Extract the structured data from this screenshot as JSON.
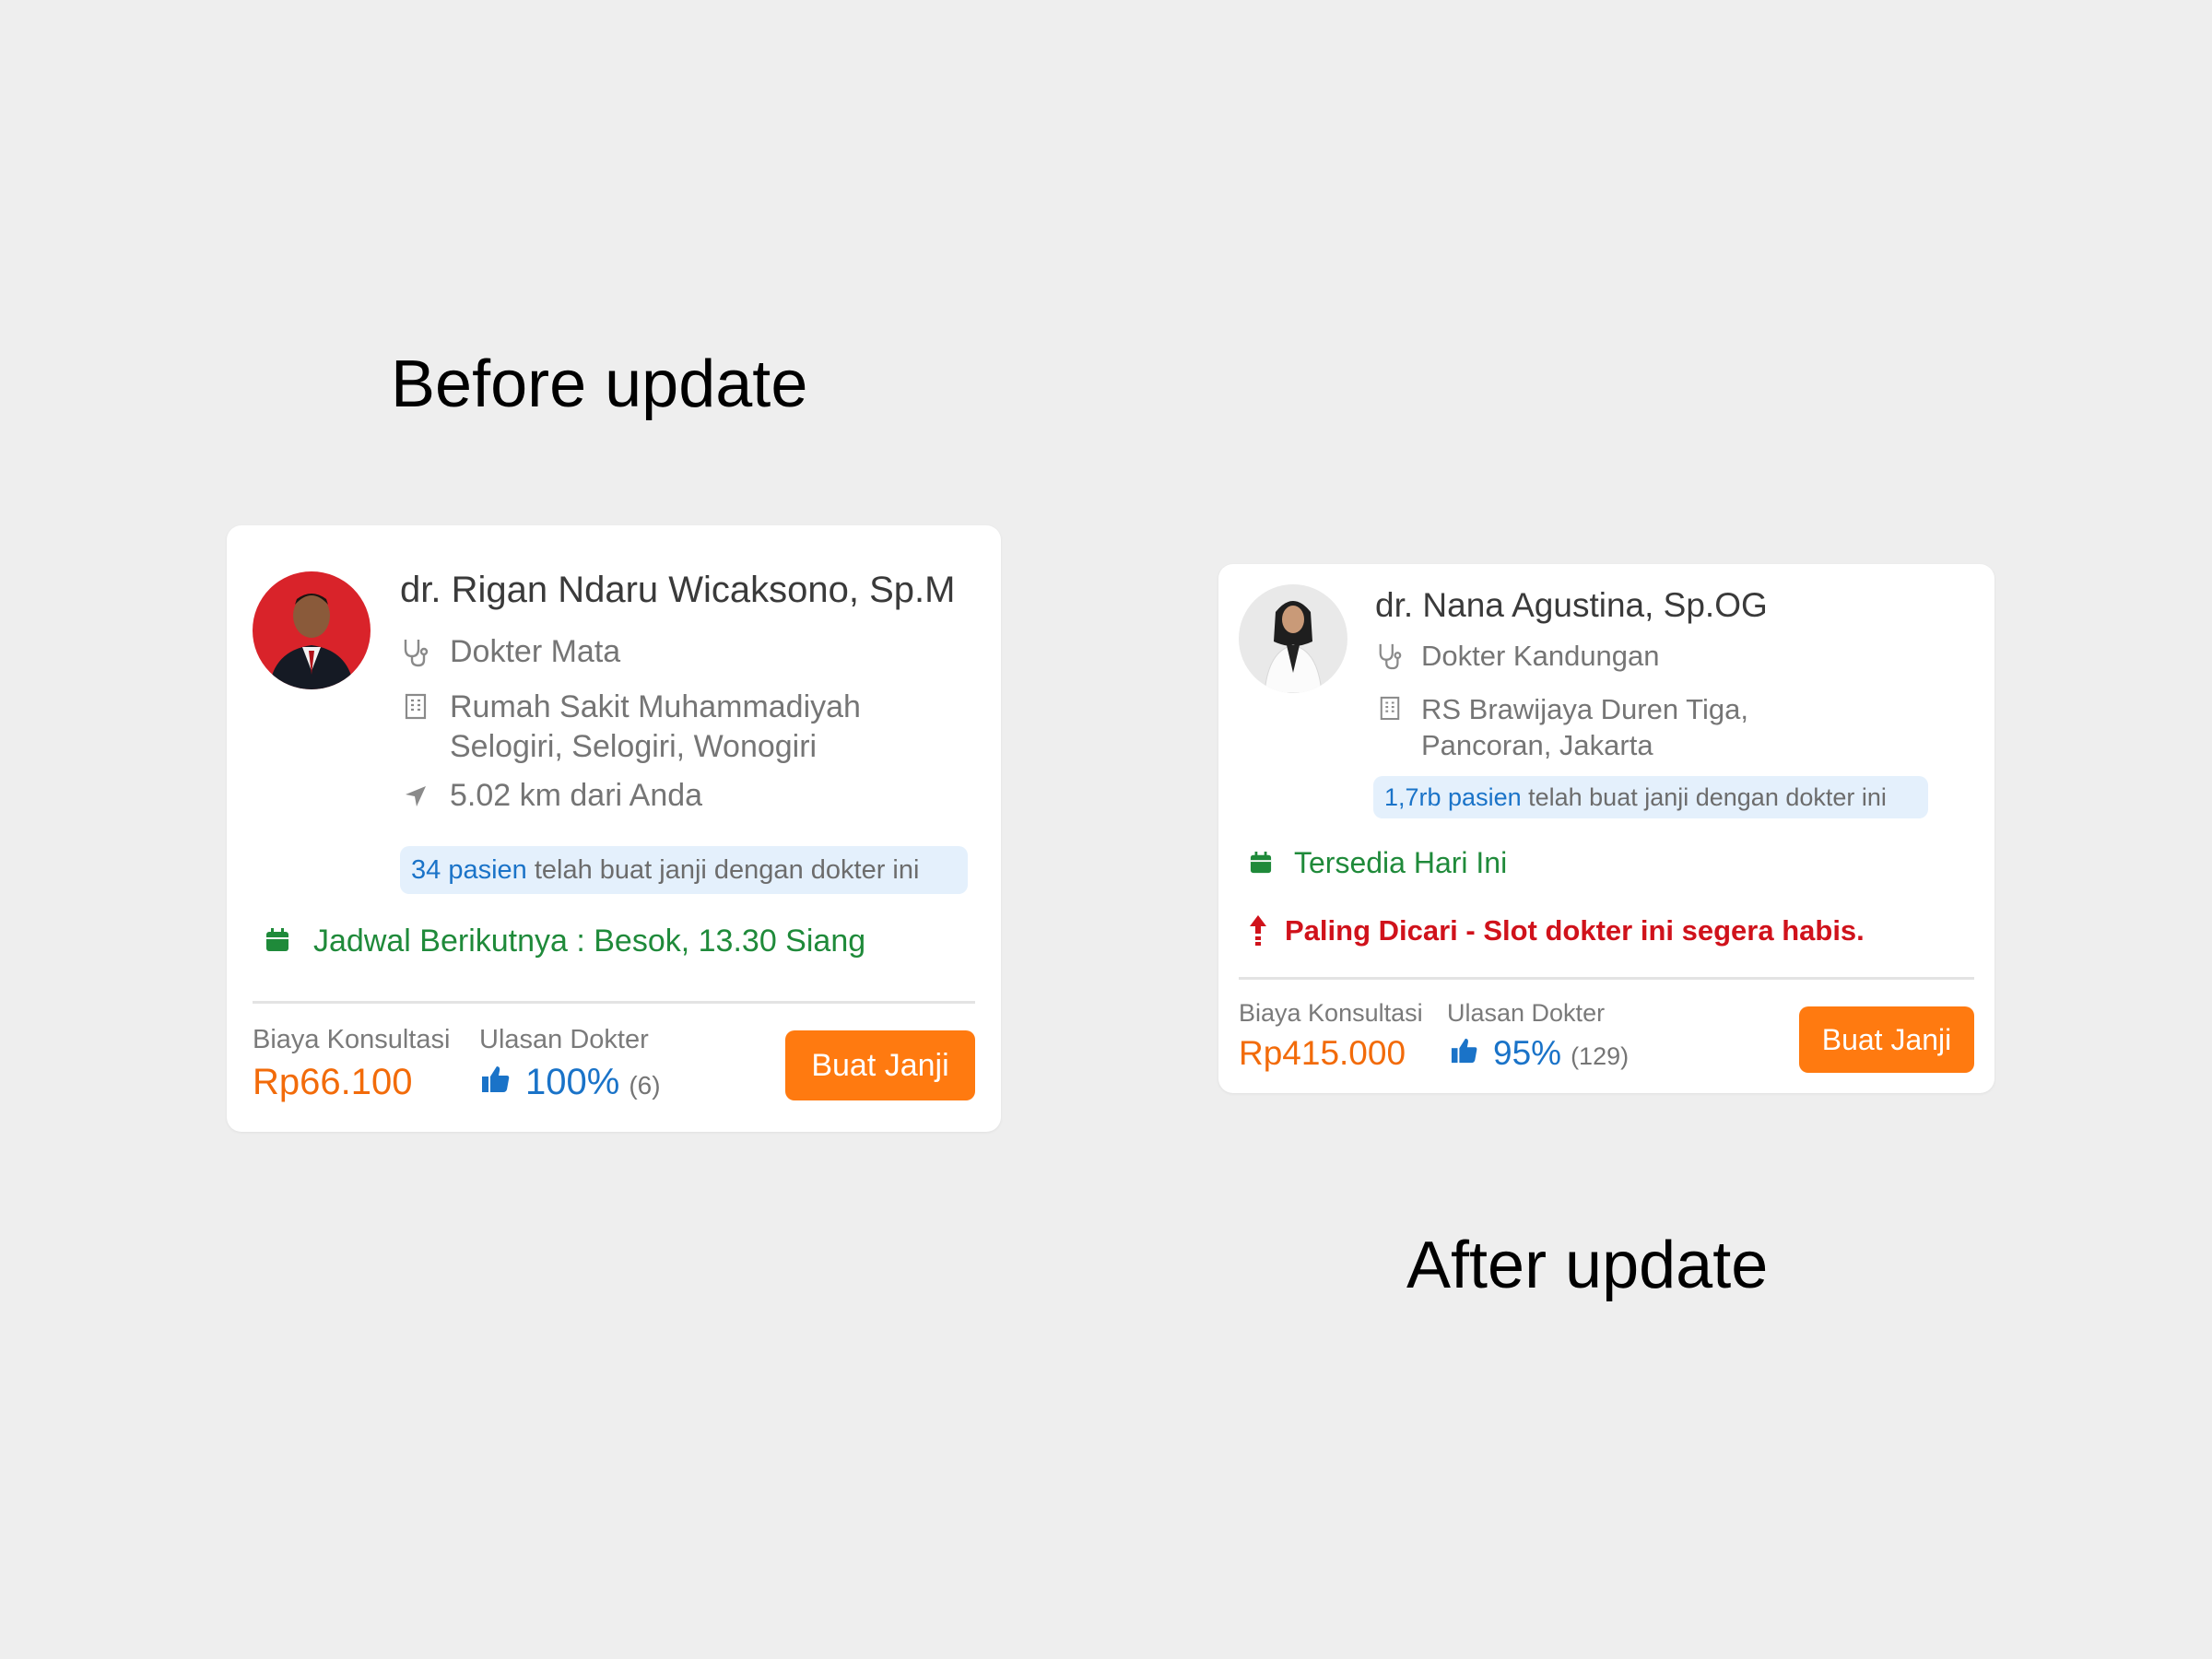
{
  "headings": {
    "before": "Before update",
    "after": "After update"
  },
  "colors": {
    "price": "#f26b0a",
    "link": "#1a73c8",
    "available": "#1f8a3a",
    "alert": "#d0121b",
    "button": "#ff7a10"
  },
  "before": {
    "name": "dr. Rigan Ndaru Wicaksono, Sp.M",
    "specialty": {
      "icon": "stethoscope-icon",
      "text": "Dokter Mata"
    },
    "hospital": {
      "icon": "hospital-icon",
      "text": "Rumah Sakit Muhammadiyah\nSelogiri, Selogiri, Wonogiri"
    },
    "distance": {
      "icon": "location-arrow-icon",
      "text": "5.02 km dari Anda"
    },
    "patients": {
      "count": "34 pasien",
      "text": " telah buat janji dengan dokter ini"
    },
    "schedule": {
      "icon": "calendar-icon",
      "text": "Jadwal Berikutnya : Besok, 13.30 Siang"
    },
    "fee_label": "Biaya Konsultasi",
    "fee": "Rp66.100",
    "review_label": "Ulasan Dokter",
    "rating": {
      "icon": "thumbs-up-icon",
      "percent": "100%",
      "count": "(6)"
    },
    "button": "Buat Janji"
  },
  "after": {
    "name": "dr. Nana Agustina, Sp.OG",
    "specialty": {
      "icon": "stethoscope-icon",
      "text": "Dokter Kandungan"
    },
    "hospital": {
      "icon": "hospital-icon",
      "text": "RS Brawijaya Duren Tiga,\nPancoran, Jakarta"
    },
    "patients": {
      "count": "1,7rb pasien",
      "text": " telah buat janji dengan dokter ini"
    },
    "availability": {
      "icon": "calendar-icon",
      "text": "Tersedia Hari Ini"
    },
    "alert": {
      "icon": "trending-up-arrow-icon",
      "text": "Paling Dicari - Slot dokter ini segera habis."
    },
    "fee_label": "Biaya Konsultasi",
    "fee": "Rp415.000",
    "review_label": "Ulasan Dokter",
    "rating": {
      "icon": "thumbs-up-icon",
      "percent": "95%",
      "count": "(129)"
    },
    "button": "Buat Janji"
  }
}
